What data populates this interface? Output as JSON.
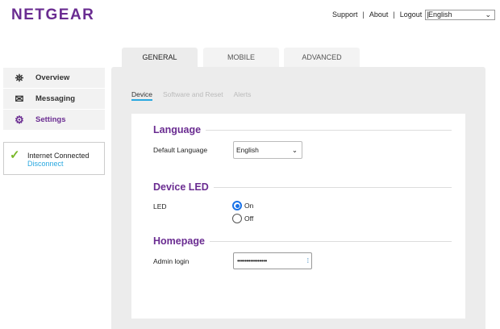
{
  "header": {
    "logo": "NETGEAR",
    "links": [
      "Support",
      "About",
      "Logout"
    ],
    "language": "English"
  },
  "tabs": [
    "GENERAL",
    "MOBILE",
    "ADVANCED"
  ],
  "sidebar": {
    "items": [
      {
        "label": "Overview",
        "icon": "network-icon"
      },
      {
        "label": "Messaging",
        "icon": "envelope-icon"
      },
      {
        "label": "Settings",
        "icon": "gears-icon"
      }
    ]
  },
  "status": {
    "text": "Internet Connected",
    "action": "Disconnect",
    "color": "#7ab829"
  },
  "subtabs": [
    "Device",
    "Software and Reset",
    "Alerts"
  ],
  "language": {
    "title": "Language",
    "label": "Default Language",
    "value": "English"
  },
  "led": {
    "title": "Device LED",
    "label": "LED",
    "options": [
      "On",
      "Off"
    ],
    "selected": "On"
  },
  "homepage": {
    "title": "Homepage",
    "label": "Admin login",
    "value": "••••••••••••••••"
  },
  "colors": {
    "brand": "#6a2c91",
    "accent": "#29a8e0"
  }
}
